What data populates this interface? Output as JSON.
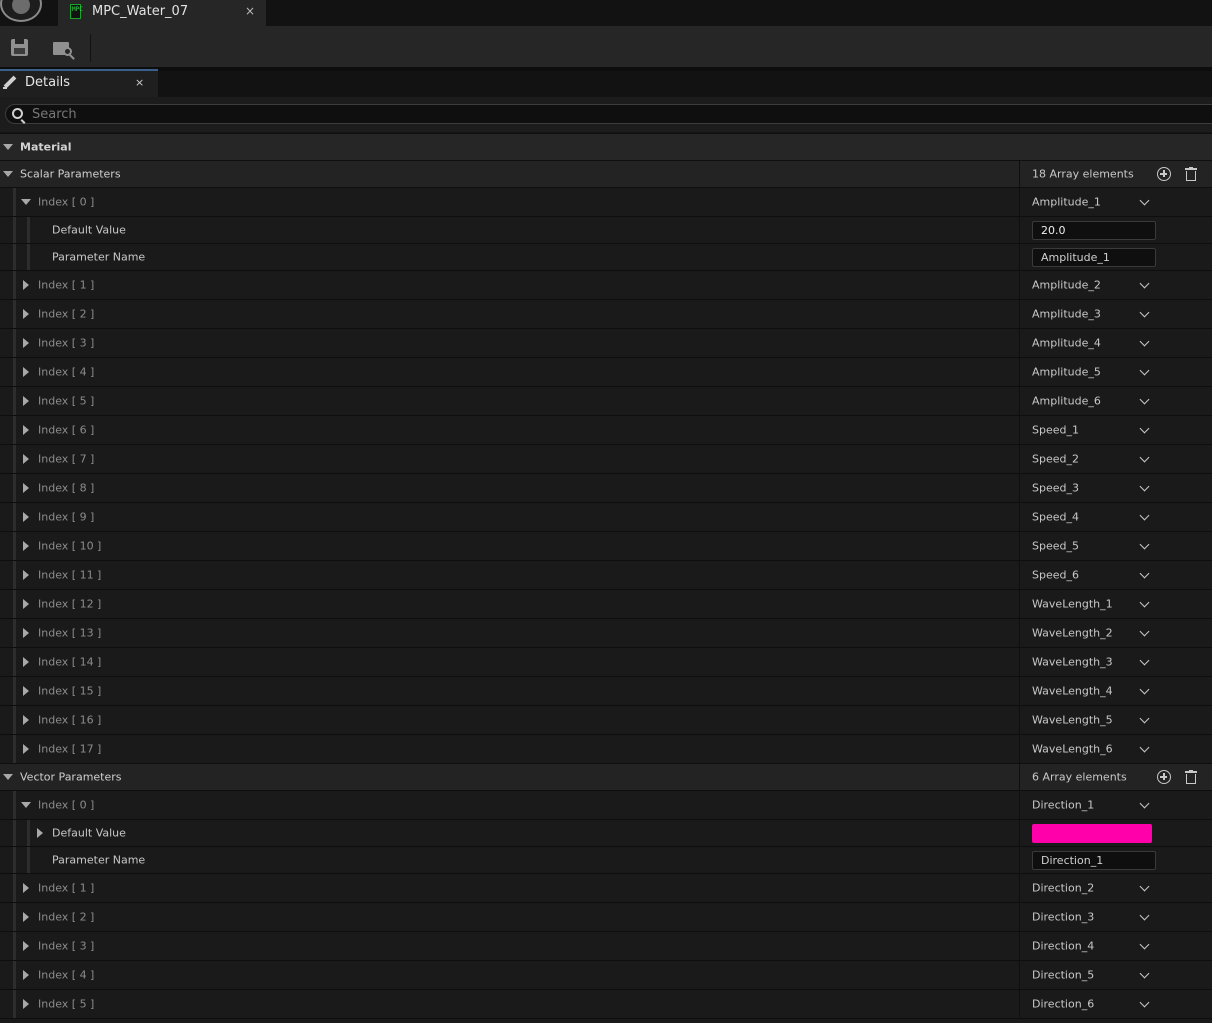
{
  "document_tab": {
    "title": "MPC_Water_07",
    "icon_text": "MPC",
    "close_glyph": "×"
  },
  "toolbar": {
    "save_icon": "save-icon",
    "browse_icon": "browse-content-icon"
  },
  "details_tab": {
    "label": "Details",
    "close_glyph": "×"
  },
  "search": {
    "placeholder": "Search"
  },
  "material": {
    "label": "Material"
  },
  "scalar": {
    "label": "Scalar Parameters",
    "count": "18 Array elements",
    "expanded": {
      "index": "Index [ 0 ]",
      "name": "Amplitude_1",
      "default_label": "Default Value",
      "default_value": "20.0",
      "param_label": "Parameter Name",
      "param_value": "Amplitude_1"
    },
    "items": [
      {
        "index": "Index [ 1 ]",
        "name": "Amplitude_2"
      },
      {
        "index": "Index [ 2 ]",
        "name": "Amplitude_3"
      },
      {
        "index": "Index [ 3 ]",
        "name": "Amplitude_4"
      },
      {
        "index": "Index [ 4 ]",
        "name": "Amplitude_5"
      },
      {
        "index": "Index [ 5 ]",
        "name": "Amplitude_6"
      },
      {
        "index": "Index [ 6 ]",
        "name": "Speed_1"
      },
      {
        "index": "Index [ 7 ]",
        "name": "Speed_2"
      },
      {
        "index": "Index [ 8 ]",
        "name": "Speed_3"
      },
      {
        "index": "Index [ 9 ]",
        "name": "Speed_4"
      },
      {
        "index": "Index [ 10 ]",
        "name": "Speed_5"
      },
      {
        "index": "Index [ 11 ]",
        "name": "Speed_6"
      },
      {
        "index": "Index [ 12 ]",
        "name": "WaveLength_1"
      },
      {
        "index": "Index [ 13 ]",
        "name": "WaveLength_2"
      },
      {
        "index": "Index [ 14 ]",
        "name": "WaveLength_3"
      },
      {
        "index": "Index [ 15 ]",
        "name": "WaveLength_4"
      },
      {
        "index": "Index [ 16 ]",
        "name": "WaveLength_5"
      },
      {
        "index": "Index [ 17 ]",
        "name": "WaveLength_6"
      }
    ]
  },
  "vector": {
    "label": "Vector Parameters",
    "count": "6 Array elements",
    "expanded": {
      "index": "Index [ 0 ]",
      "name": "Direction_1",
      "default_label": "Default Value",
      "default_color": "#ff00aa",
      "param_label": "Parameter Name",
      "param_value": "Direction_1"
    },
    "items": [
      {
        "index": "Index [ 1 ]",
        "name": "Direction_2"
      },
      {
        "index": "Index [ 2 ]",
        "name": "Direction_3"
      },
      {
        "index": "Index [ 3 ]",
        "name": "Direction_4"
      },
      {
        "index": "Index [ 4 ]",
        "name": "Direction_5"
      },
      {
        "index": "Index [ 5 ]",
        "name": "Direction_6"
      }
    ]
  }
}
